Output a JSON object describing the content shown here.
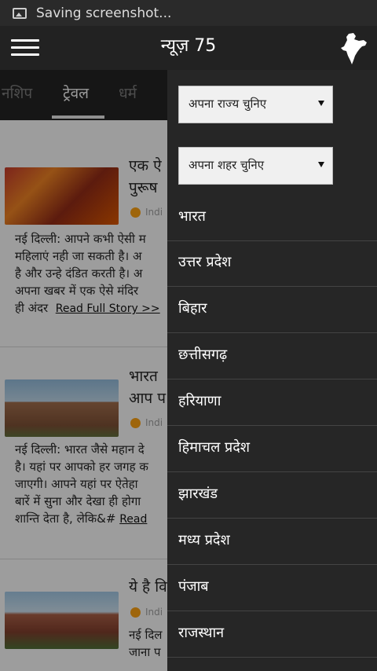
{
  "status": {
    "text": "Saving screenshot..."
  },
  "app": {
    "title": "न्यूज़ 75"
  },
  "tabs": [
    {
      "label": "नशिप"
    },
    {
      "label": "ट्रेवल"
    },
    {
      "label": "धर्म"
    }
  ],
  "articles": [
    {
      "title_lines": [
        "एक ऐ",
        "पुरूष"
      ],
      "source": "Indi",
      "summary_lines": [
        "नई दिल्ली: आपने कभी ऐसी म",
        "महिलाएं नही जा सकती है। अ",
        "है और उन्हे दंडित करती है। अ",
        "अपना खबर में एक ऐसे मंदिर"
      ],
      "last_line_text": "ही अंदर",
      "read_more": "Read Full Story >>"
    },
    {
      "title_lines": [
        "भारत",
        "आप प"
      ],
      "source": "Indi",
      "summary_lines": [
        "नई दिल्ली: भारत जैसे महान दे",
        "है। यहां पर आपको हर जगह क",
        "जाएगी। आपने यहां पर ऐतेहा",
        "बारें में सुना और देखा ही होगा"
      ],
      "last_line_text": "शान्ति देता है, लेकि&#",
      "read_more": "Read"
    },
    {
      "title_lines": [
        "ये है वि"
      ],
      "source": "Indi",
      "summary_lines": [
        "नई दिल",
        "जाना प"
      ]
    }
  ],
  "drawer": {
    "state_select": "अपना राज्य चुनिए",
    "city_select": "अपना शहर चुनिए",
    "states": [
      "भारत",
      "उत्तर प्रदेश",
      "बिहार",
      "छत्तीसगढ़",
      "हरियाणा",
      "हिमाचल प्रदेश",
      "झारखंड",
      "मध्य प्रदेश",
      "पंजाब",
      "राजस्थान"
    ]
  },
  "colors": {
    "appbar": "#222222",
    "drawer": "#262626",
    "source_dot": "#f39c12"
  },
  "icons": [
    "image-icon",
    "hamburger-menu-icon",
    "india-map-icon",
    "dropdown-arrow-icon"
  ]
}
